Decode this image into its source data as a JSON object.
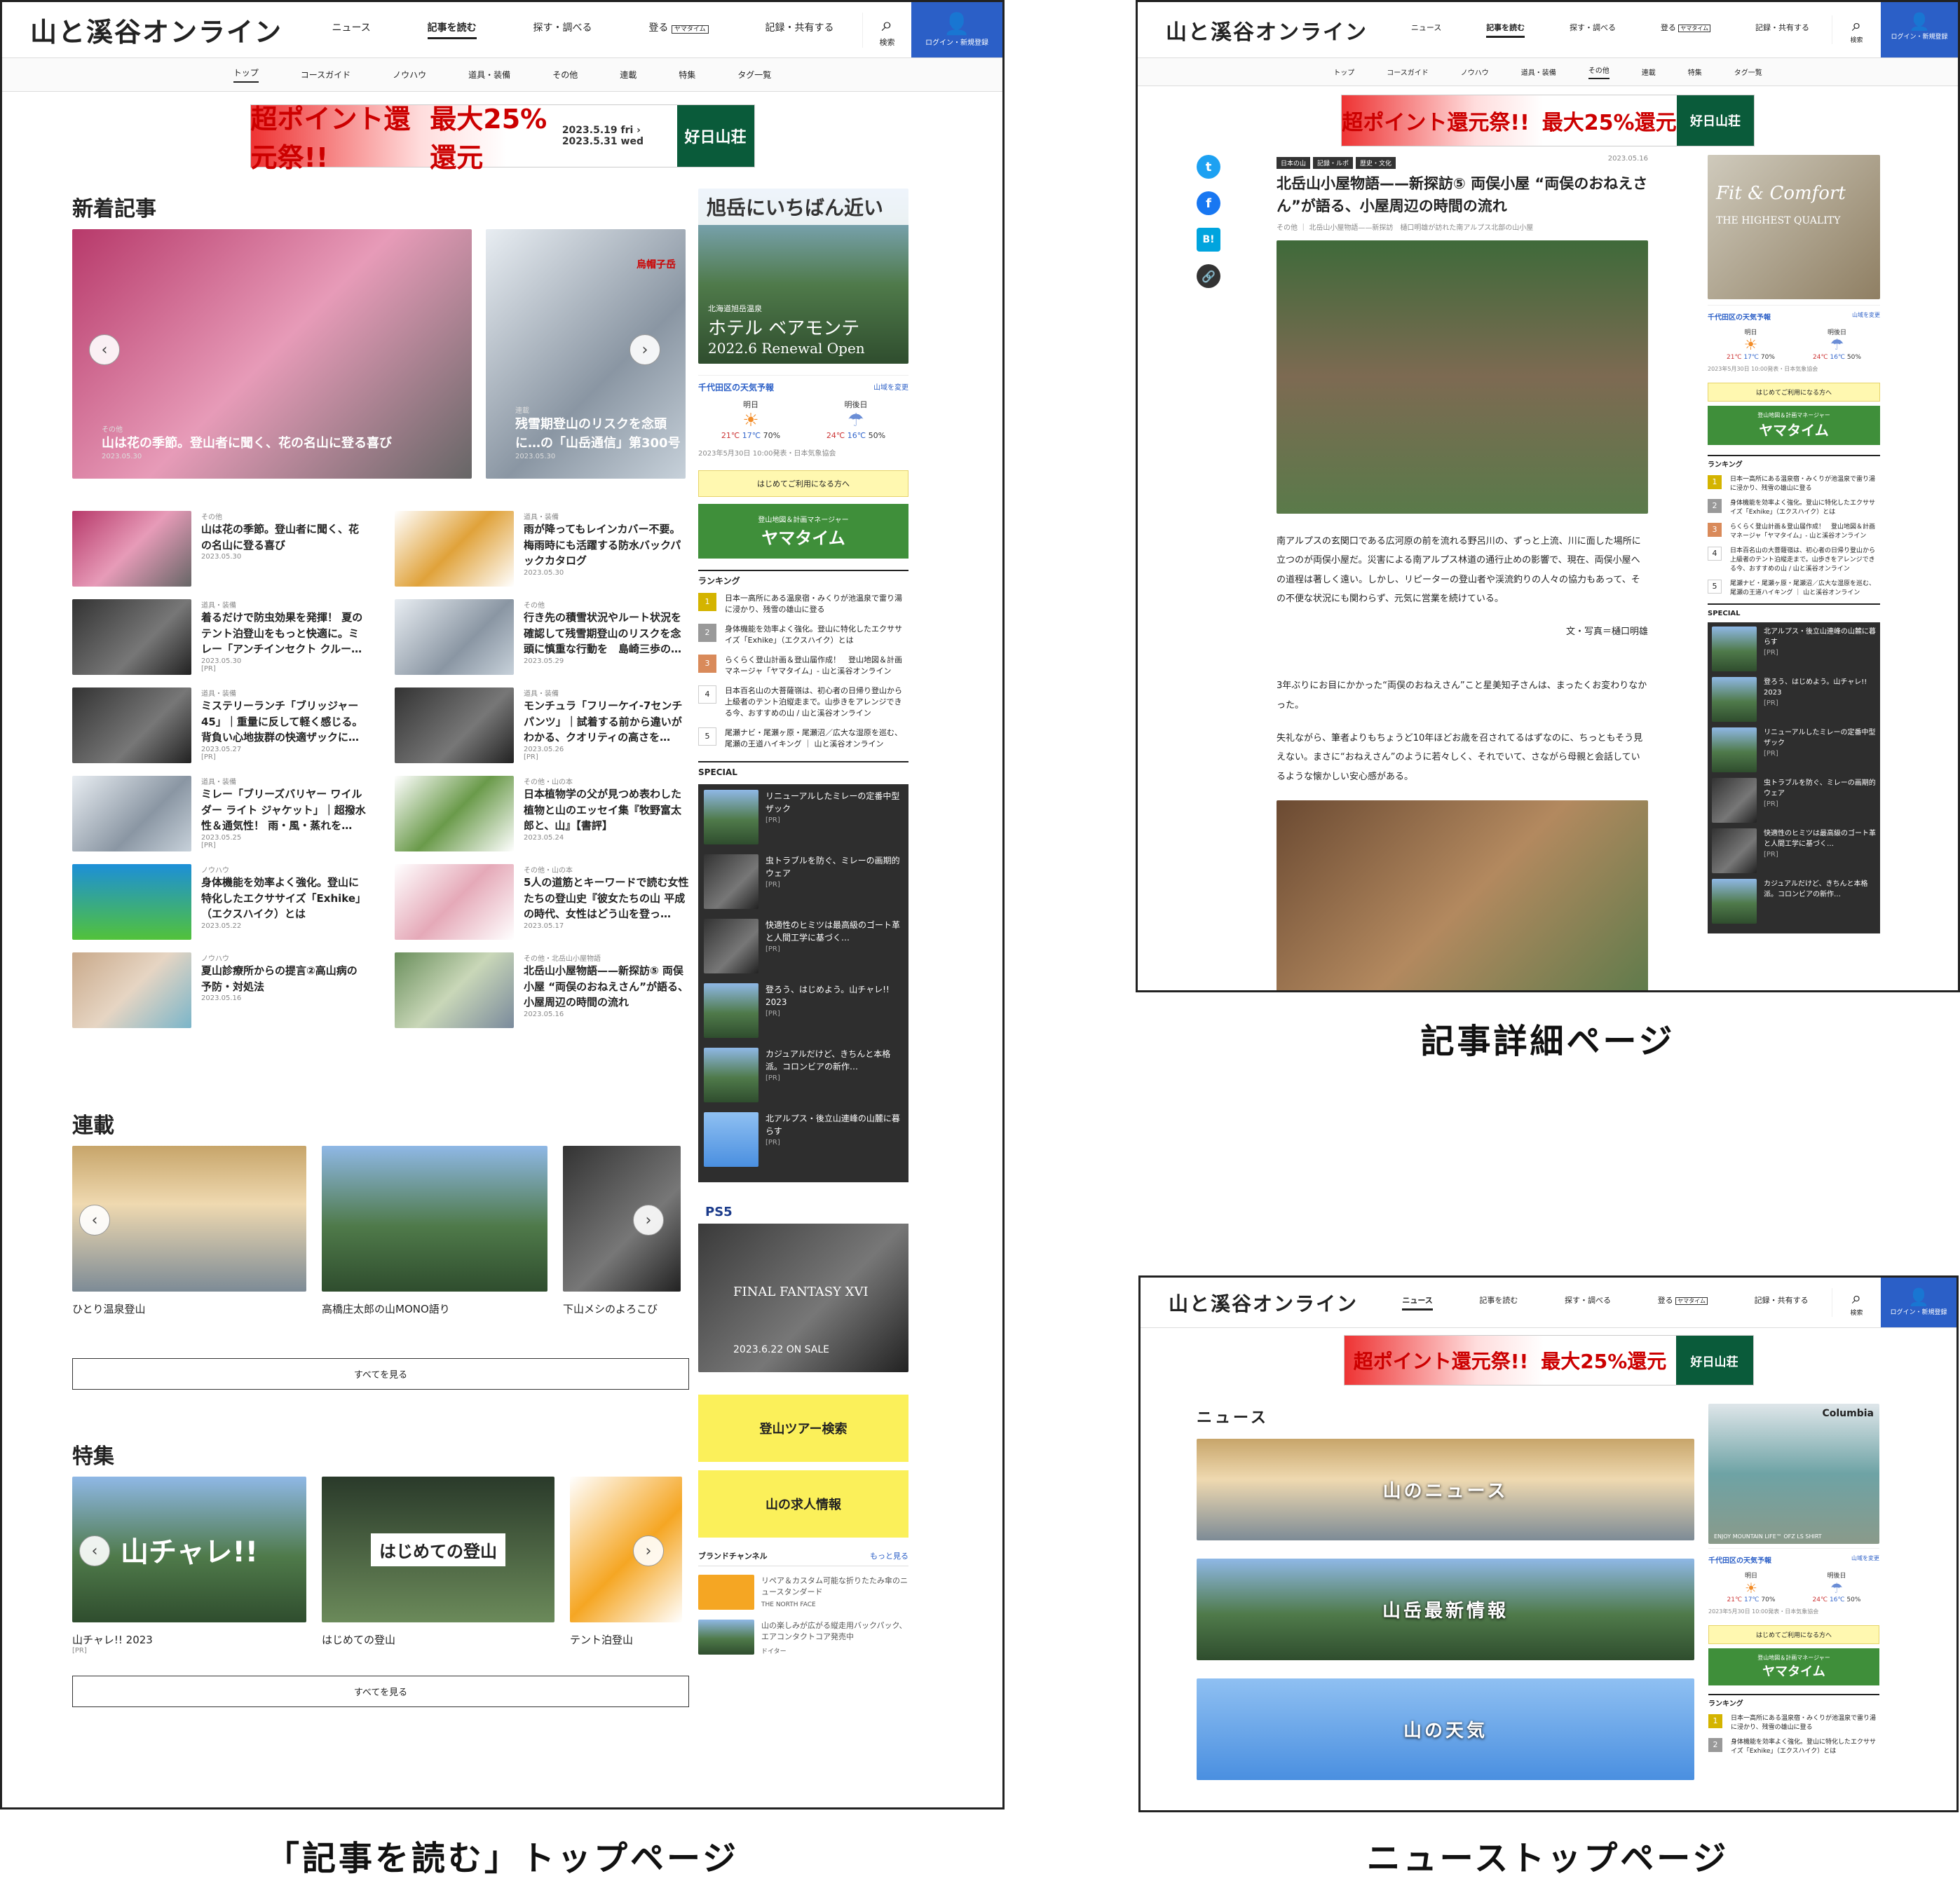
{
  "header": {
    "logo": "山と溪谷オンライン",
    "nav": [
      "ニュース",
      "記事を読む",
      "探す・調べる",
      "登る",
      "記録・共有する"
    ],
    "yamatime_badge": "ヤマタイム",
    "search": "検索",
    "login": "ログイン・新規登録"
  },
  "subnav": [
    "トップ",
    "コースガイド",
    "ノウハウ",
    "道具・装備",
    "その他",
    "連載",
    "特集",
    "タグ一覧"
  ],
  "banner": {
    "main": "超ポイント還元祭!!",
    "pct": "最大25%還元",
    "dates": "2023.5.19 fri › 2023.5.31 wed",
    "brand": "好日山荘"
  },
  "captions": {
    "top": "「記事を読む」トップページ",
    "detail": "記事詳細ページ",
    "news": "ニューストップページ"
  },
  "top": {
    "new_heading": "新着記事",
    "hero": [
      {
        "cat": "その他",
        "title": "山は花の季節。登山者に聞く、花の名山に登る喜び",
        "date": "2023.05.30"
      },
      {
        "cat": "連載",
        "title": "残雪期登山のリスクを念頭に…の「山岳通信」第300号",
        "date": "2023.05.30",
        "tag": "烏帽子岳"
      }
    ],
    "articles": [
      {
        "cat": "その他",
        "title": "山は花の季節。登山者に聞く、花の名山に登る喜び",
        "date": "2023.05.30",
        "pr": ""
      },
      {
        "cat": "道具・装備",
        "title": "雨が降ってもレインカバー不要。梅雨時にも活躍する防水バックパックカタログ",
        "date": "2023.05.30",
        "pr": ""
      },
      {
        "cat": "道具・装備",
        "title": "着るだけで防虫効果を発揮！ 夏のテント泊登山をもっと快適に。ミレー「アンチインセクト クルー…",
        "date": "2023.05.30",
        "pr": "[PR]"
      },
      {
        "cat": "その他",
        "title": "行き先の積雪状況やルート状況を確認して残雪期登山のリスクを念頭に慎重な行動を　島崎三歩の…",
        "date": "2023.05.29",
        "pr": ""
      },
      {
        "cat": "道具・装備",
        "title": "ミステリーランチ「ブリッジャー45」｜重量に反して軽く感じる。背負い心地抜群の快適ザックに…",
        "date": "2023.05.27",
        "pr": "[PR]"
      },
      {
        "cat": "道具・装備",
        "title": "モンチュラ「フリーケイ-7センチパンツ」｜試着する前から違いがわかる、クオリティの高さを…",
        "date": "2023.05.26",
        "pr": "[PR]"
      },
      {
        "cat": "道具・装備",
        "title": "ミレー「ブリーズバリヤー ワイルダー ライト ジャケット」｜超撥水性＆通気性！ 雨・風・蒸れを…",
        "date": "2023.05.25",
        "pr": "[PR]"
      },
      {
        "cat": "その他・山の本",
        "title": "日本植物学の父が見つめ表わした植物と山のエッセイ集『牧野富太郎と、山』【書評】",
        "date": "2023.05.24",
        "pr": ""
      },
      {
        "cat": "ノウハウ",
        "title": "身体機能を効率よく強化。登山に特化したエクササイズ「Exhike」（エクスハイク）とは",
        "date": "2023.05.22",
        "pr": ""
      },
      {
        "cat": "その他・山の本",
        "title": "5人の道筋とキーワードで読む女性たちの登山史『彼女たちの山 平成の時代、女性はどう山を登っ…",
        "date": "2023.05.17",
        "pr": ""
      },
      {
        "cat": "ノウハウ",
        "title": "夏山診療所からの提言②高山病の予防・対処法",
        "date": "2023.05.16",
        "pr": ""
      },
      {
        "cat": "その他・北岳山小屋物語",
        "title": "北岳山小屋物語——新探訪⑤ 両俣小屋 “両俣のおねえさん”が語る、小屋周辺の時間の流れ",
        "date": "2023.05.16",
        "pr": ""
      }
    ],
    "series_heading": "連載",
    "series": [
      "ひとり温泉登山",
      "高橋庄太郎の山MONO語り",
      "下山メシのよろこび"
    ],
    "see_all": "すべてを見る",
    "feature_heading": "特集",
    "features": [
      {
        "label": "山チャレ!! 2023",
        "pr": "[PR]",
        "overlay": "山チャレ!!"
      },
      {
        "label": "はじめての登山",
        "pr": "",
        "overlay": "はじめての登山"
      },
      {
        "label": "テント泊登山",
        "pr": "",
        "overlay": ""
      }
    ],
    "side": {
      "hotel_title": "旭岳にいちばん近い",
      "hotel_sub": "北海道旭岳温泉",
      "hotel_name": "ホテル ベアモンテ",
      "hotel_open": "2022.6 Renewal Open",
      "tour": "登山ツアー検索",
      "jobs": "山の求人情報",
      "ps5": "PS5",
      "ff": "FINAL FANTASY XVI",
      "ff_date": "2023.6.22 ON SALE",
      "brand_h": "ブランドチャンネル",
      "brand_more": "もっと見る",
      "brand1": "リペア＆カスタム可能な折りたたみ傘のニュースタンダード",
      "brand1_name": "THE NORTH FACE",
      "brand2": "山の楽しみが広がる縦走用バックパック、エアコンタクトコア発売中",
      "brand2_name": "ドイター"
    }
  },
  "weather": {
    "title": "千代田区の天気予報",
    "change": "山域を変更",
    "days": [
      {
        "label": "明日",
        "hi": "21℃",
        "lo": "17℃",
        "rain": "70%"
      },
      {
        "label": "明後日",
        "hi": "24℃",
        "lo": "16℃",
        "rain": "50%"
      }
    ],
    "note": "2023年5月30日 10:00発表・日本気象協会"
  },
  "newbie": "はじめてご利用になる方へ",
  "yamatime": {
    "sub": "登山地図＆計画マネージャー",
    "name": "ヤマタイム"
  },
  "ranking": {
    "heading": "ランキング",
    "items": [
      "日本一高所にある温泉宿・みくりが池温泉で雷り湯に浸かり、残雪の雄山に登る",
      "身体機能を効率よく強化。登山に特化したエクササイズ「Exhike」（エクスハイク）とは",
      "らくらく登山計画＆登山届作成！　登山地図＆計画マネージャ「ヤマタイム」- 山と溪谷オンライン",
      "日本百名山の大菩薩嶺は、初心者の日帰り登山から上級者のテント泊縦走まで。山歩きをアレンジできる今、おすすめの山 / 山と溪谷オンライン",
      "尾瀬ナビ・尾瀬ヶ原・尾瀬沼／広大な湿原を巡む、尾瀬の王道ハイキング ｜ 山と溪谷オンライン"
    ]
  },
  "special": {
    "heading": "SPECIAL",
    "items": [
      "リニューアルしたミレーの定番中型ザック",
      "虫トラブルを防ぐ、ミレーの画期的ウェア",
      "快適性のヒミツは最高級のゴート革と人間工学に基づく…",
      "登ろう、はじめよう。山チャレ!! 2023",
      "カジュアルだけど、きちんと本格派。コロンビアの新作…",
      "北アルプス・後立山連峰の山麓に暮らす"
    ],
    "pr": "[PR]"
  },
  "detail": {
    "tags": [
      "日本の山",
      "記録・ルポ",
      "歴史・文化"
    ],
    "date": "2023.05.16",
    "title": "北岳山小屋物語——新探訪⑤ 両俣小屋 “両俣のおねえさん”が語る、小屋周辺の時間の流れ",
    "byline": "その他 ｜ 北岳山小屋物語——新探訪　樋口明雄が訪れた南アルプス北部の山小屋",
    "p1": "南アルプスの玄関口である広河原の前を流れる野呂川の、ずっと上流、川に面した場所に立つのが両俣小屋だ。災害による南アルプス林道の通行止めの影響で、現在、両俣小屋への道程は著しく遠い。しかし、リピーターの登山者や渓流釣りの人々の協力もあって、その不便な状況にも関わらず、元気に営業を続けている。",
    "credit": "文・写真＝樋口明雄",
    "p2": "3年ぶりにお目にかかった“両俣のおねえさん”こと星美知子さんは、まったくお変わりなかった。",
    "p3": "失礼ながら、筆者よりもちょうど10年ほどお歳を召されてるはずなのに、ちっともそう見えない。まさに“おねえさん”のように若々しく、それでいて、さながら母親と会話しているような懐かしい安心感がある。",
    "ad_text": "Fit & Comfort",
    "ad_sub": "THE HIGHEST QUALITY"
  },
  "news": {
    "heading": "ニュース",
    "bars": [
      "山のニュース",
      "山岳最新情報",
      "山の天気"
    ],
    "ad_brand": "Columbia",
    "ad_text": "ENJOY MOUNTAIN LIFE™ OFZ LS SHIRT"
  }
}
